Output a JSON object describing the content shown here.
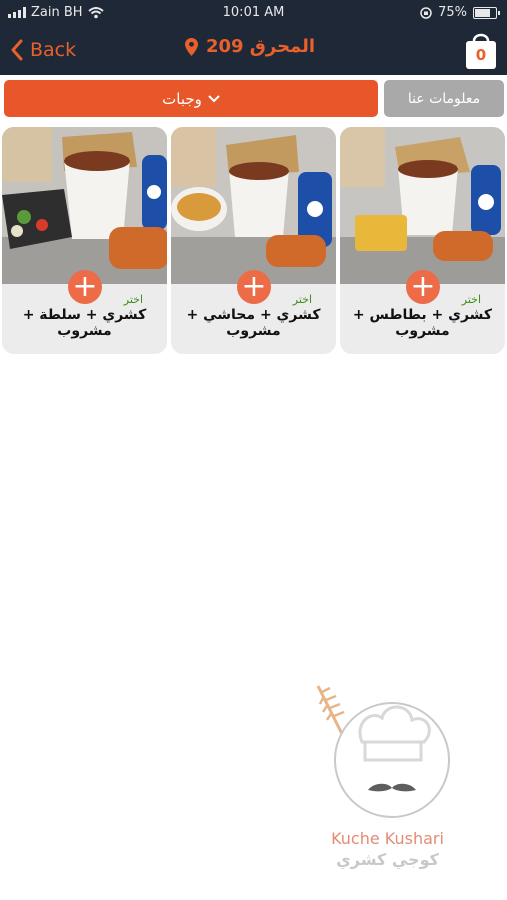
{
  "status": {
    "carrier": "Zain BH",
    "time": "10:01 AM",
    "battery": "75%",
    "battery_level": 0.75
  },
  "nav": {
    "back_label": "Back",
    "title": "المحرق 209",
    "cart_count": "0"
  },
  "tabs": {
    "menu_label": "وجبات",
    "info_label": "معلومات عنا"
  },
  "products": [
    {
      "title": "كشري + بطاطس + مشروب",
      "choose_label": "اختر",
      "add_icon": "plus-icon"
    },
    {
      "title": "كشري + محاشي + مشروب",
      "choose_label": "اختر",
      "add_icon": "plus-icon"
    },
    {
      "title": "كشري + سلطة + مشروب",
      "choose_label": "اختر",
      "add_icon": "plus-icon"
    }
  ],
  "brand": {
    "name_en": "Kuche Kushari",
    "name_ar": "كوجي كشري"
  },
  "colors": {
    "header": "#1f2836",
    "accent": "#e8612c",
    "tab_active": "#e8572a",
    "tab_inactive": "#a9a9a9",
    "choose": "#3c8d1c"
  }
}
